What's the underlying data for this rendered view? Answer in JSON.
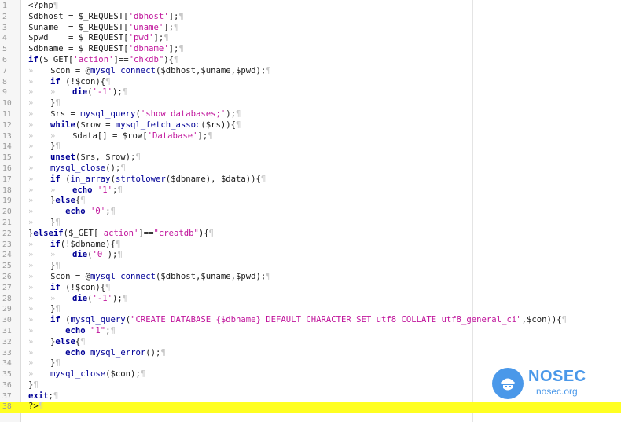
{
  "editor": {
    "highlight_line": 38,
    "lines": [
      {
        "n": "1",
        "t": "<?php"
      },
      {
        "n": "2",
        "t": "$dbhost = $_REQUEST['dbhost'];"
      },
      {
        "n": "3",
        "t": "$uname  = $_REQUEST['uname'];"
      },
      {
        "n": "4",
        "t": "$pwd    = $_REQUEST['pwd'];"
      },
      {
        "n": "5",
        "t": "$dbname = $_REQUEST['dbname'];"
      },
      {
        "n": "6",
        "t": "if($_GET['action']==\"chkdb\"){"
      },
      {
        "n": "7",
        "t": "    $con = @mysql_connect($dbhost,$uname,$pwd);"
      },
      {
        "n": "8",
        "t": "    if (!$con){"
      },
      {
        "n": "9",
        "t": "        die('-1');"
      },
      {
        "n": "10",
        "t": "    }"
      },
      {
        "n": "11",
        "t": "    $rs = mysql_query('show databases;');"
      },
      {
        "n": "12",
        "t": "    while($row = mysql_fetch_assoc($rs)){"
      },
      {
        "n": "13",
        "t": "        $data[] = $row['Database'];"
      },
      {
        "n": "14",
        "t": "    }"
      },
      {
        "n": "15",
        "t": "    unset($rs, $row);"
      },
      {
        "n": "16",
        "t": "    mysql_close();"
      },
      {
        "n": "17",
        "t": "    if (in_array(strtolower($dbname), $data)){"
      },
      {
        "n": "18",
        "t": "        echo '1';"
      },
      {
        "n": "19",
        "t": "    }else{"
      },
      {
        "n": "20",
        "t": "       echo '0';"
      },
      {
        "n": "21",
        "t": "    }"
      },
      {
        "n": "22",
        "t": "}elseif($_GET['action']==\"creatdb\"){"
      },
      {
        "n": "23",
        "t": "    if(!$dbname){"
      },
      {
        "n": "24",
        "t": "        die('0');"
      },
      {
        "n": "25",
        "t": "    }"
      },
      {
        "n": "26",
        "t": "    $con = @mysql_connect($dbhost,$uname,$pwd);"
      },
      {
        "n": "27",
        "t": "    if (!$con){"
      },
      {
        "n": "28",
        "t": "        die('-1');"
      },
      {
        "n": "29",
        "t": "    }"
      },
      {
        "n": "30",
        "t": "    if (mysql_query(\"CREATE DATABASE {$dbname} DEFAULT CHARACTER SET utf8 COLLATE utf8_general_ci\",$con)){"
      },
      {
        "n": "31",
        "t": "       echo \"1\";"
      },
      {
        "n": "32",
        "t": "    }else{"
      },
      {
        "n": "33",
        "t": "       echo mysql_error();"
      },
      {
        "n": "34",
        "t": "    }"
      },
      {
        "n": "35",
        "t": "    mysql_close($con);"
      },
      {
        "n": "36",
        "t": "}"
      },
      {
        "n": "37",
        "t": "exit;"
      },
      {
        "n": "38",
        "t": "?>"
      }
    ]
  },
  "watermark": {
    "brand": "NOSEC",
    "domain": "nosec.org",
    "color": "#2b87e6",
    "icon": "hacker-mask-icon"
  }
}
